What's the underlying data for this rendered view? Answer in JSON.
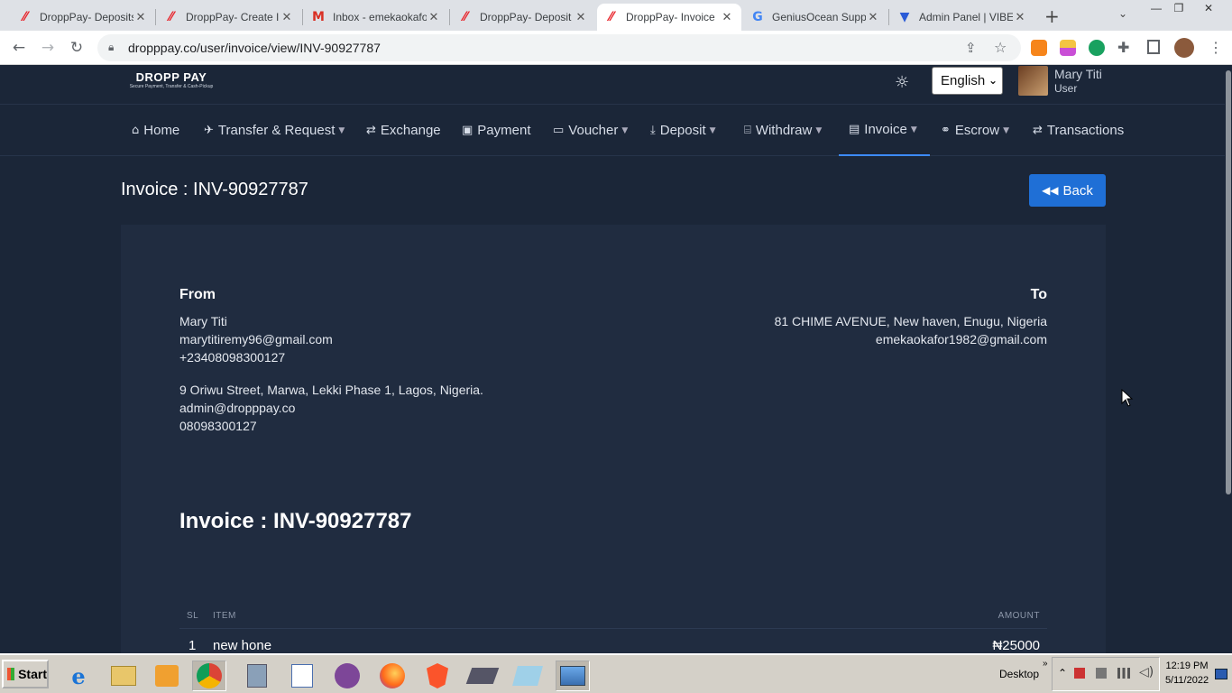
{
  "browser": {
    "tabs": [
      {
        "title": "DroppPay- Deposits",
        "icon": "droppay-logo-icon"
      },
      {
        "title": "DroppPay- Create Ir",
        "icon": "droppay-logo-icon"
      },
      {
        "title": "Inbox - emekaokafor",
        "icon": "gmail-icon"
      },
      {
        "title": "DroppPay- Deposit",
        "icon": "droppay-logo-icon"
      },
      {
        "title": "DroppPay- Invoice",
        "icon": "droppay-logo-icon",
        "active": true
      },
      {
        "title": "GeniusOcean Suppor",
        "icon": "google-icon"
      },
      {
        "title": "Admin Panel | VIBEC",
        "icon": "vibe-logo-icon"
      }
    ],
    "url": "dropppay.co/user/invoice/view/INV-90927787"
  },
  "header": {
    "logo_text": "DROPP PAY",
    "logo_tagline": "Secure Payment, Transfer & Cash-Pickup",
    "language": "English",
    "user_name": "Mary Titi",
    "user_role": "User"
  },
  "menu": [
    {
      "label": "Home",
      "icon": "home-icon"
    },
    {
      "label": "Transfer & Request",
      "icon": "paper-plane-icon",
      "dropdown": true
    },
    {
      "label": "Exchange",
      "icon": "exchange-icon"
    },
    {
      "label": "Payment",
      "icon": "bag-icon"
    },
    {
      "label": "Voucher",
      "icon": "ticket-icon",
      "dropdown": true
    },
    {
      "label": "Deposit",
      "icon": "deposit-icon",
      "dropdown": true
    },
    {
      "label": "Withdraw",
      "icon": "bank-icon",
      "dropdown": true
    },
    {
      "label": "Invoice",
      "icon": "file-icon",
      "dropdown": true,
      "active": true
    },
    {
      "label": "Escrow",
      "icon": "handshake-icon",
      "dropdown": true
    },
    {
      "label": "Transactions",
      "icon": "exchange-icon"
    }
  ],
  "page": {
    "title": "Invoice : INV-90927787",
    "back_label": "Back"
  },
  "invoice": {
    "from_heading": "From",
    "from_lines": [
      "Mary Titi",
      "marytitiremy96@gmail.com",
      "+23408098300127"
    ],
    "company_lines": [
      "9 Oriwu Street, Marwa, Lekki Phase 1, Lagos, Nigeria.",
      "admin@dropppay.co",
      "08098300127"
    ],
    "to_heading": "To",
    "to_lines": [
      "81 CHIME AVENUE, New haven, Enugu, Nigeria",
      "emekaokafor1982@gmail.com"
    ],
    "title": "Invoice : INV-90927787",
    "columns": {
      "sl": "SL",
      "item": "ITEM",
      "amount": "AMOUNT"
    },
    "rows": [
      {
        "sl": "1",
        "item": "new hone",
        "amount": "₦25000"
      }
    ]
  },
  "taskbar": {
    "start_label": "Start",
    "desktop_label": "Desktop",
    "time": "12:19 PM",
    "date": "5/11/2022"
  },
  "colors": {
    "page_bg": "#1b2638",
    "card_bg": "#202c40",
    "accent": "#1f6fd6",
    "active_underline": "#3d8bfd"
  }
}
